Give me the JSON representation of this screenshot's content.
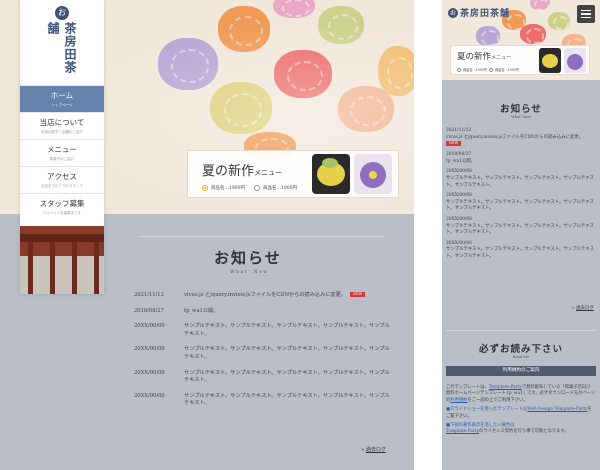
{
  "brand": {
    "crest": "お",
    "name_vertical": "茶房田茶舗",
    "name_mobile": "茶房田茶舗"
  },
  "nav": {
    "items": [
      {
        "label": "ホーム",
        "sub": "トップページ"
      },
      {
        "label": "当店について",
        "sub": "お茶の歴史・店舗のご紹介"
      },
      {
        "label": "メニュー",
        "sub": "和菓子のご紹介"
      },
      {
        "label": "アクセス",
        "sub": "当店までのアクセスマップ"
      },
      {
        "label": "スタッフ募集",
        "sub": "アルバイトを募集中です"
      }
    ],
    "active_index": 0
  },
  "banner": {
    "title_main": "夏の新作",
    "title_small": "メニュー",
    "option1": "商品名…1900円",
    "option2": "商品名…1900円"
  },
  "news": {
    "title": "お知らせ",
    "subtitle": "What' New",
    "items": [
      {
        "date": "2021/11/12",
        "text": "vivus.js とjquery.inview.jsファイルをCDNからの読み込みに変更。",
        "is_new": true
      },
      {
        "date": "2018/08/27",
        "text": "tp_wa1公開。",
        "is_new": false
      },
      {
        "date": "20XX/00/00",
        "text": "サンプルテキスト。サンプルテキスト。サンプルテキスト。サンプルテキスト。サンプルテキスト。",
        "is_new": false
      },
      {
        "date": "20XX/00/00",
        "text": "サンプルテキスト。サンプルテキスト。サンプルテキスト。サンプルテキスト。サンプルテキスト。",
        "is_new": false
      },
      {
        "date": "20XX/00/00",
        "text": "サンプルテキスト。サンプルテキスト。サンプルテキスト。サンプルテキスト。サンプルテキスト。",
        "is_new": false
      },
      {
        "date": "20XX/00/00",
        "text": "サンプルテキスト。サンプルテキスト。サンプルテキスト。サンプルテキスト。サンプルテキスト。",
        "is_new": false
      }
    ],
    "new_badge": "NEW",
    "past_log_prefix": "»",
    "past_log": "過去ログ"
  },
  "mobile": {
    "menu_icon": "hamburger-icon",
    "read_title": "必ずお読み下さい",
    "read_subtitle": "Read Me",
    "terms_bar": "利用規約のご案内",
    "terms_p1_a": "このテンプレートは、",
    "terms_p1_link1": "Template-Party",
    "terms_p1_b": "で無料配布している「和菓子店向け 無料ホームページテンプレート tp_wa1」です。必ずダウンロード先のページの",
    "terms_p1_link2": "利用規約",
    "terms_p1_c": "をご一読の上でご利用下さい。",
    "terms_p2_a": "■",
    "terms_p2_blue": "スライドショーを使ったテンプレートは",
    "terms_p2_link": "Web Design Template-Party",
    "terms_p2_c": "をご覧下さい。",
    "terms_p3_a": "■",
    "terms_p3_blue": "下部の著作表示を消したい場合は",
    "terms_p3_link": "Template-Party",
    "terms_p3_c": "のライセンス契約を行う事で可能となります。"
  },
  "colors": {
    "nav_active": "#6683ae",
    "page_bg": "#b9bec7",
    "hero_bg": "#f1e7da",
    "new_badge": "#d13a3a",
    "brand": "#3d5476"
  }
}
